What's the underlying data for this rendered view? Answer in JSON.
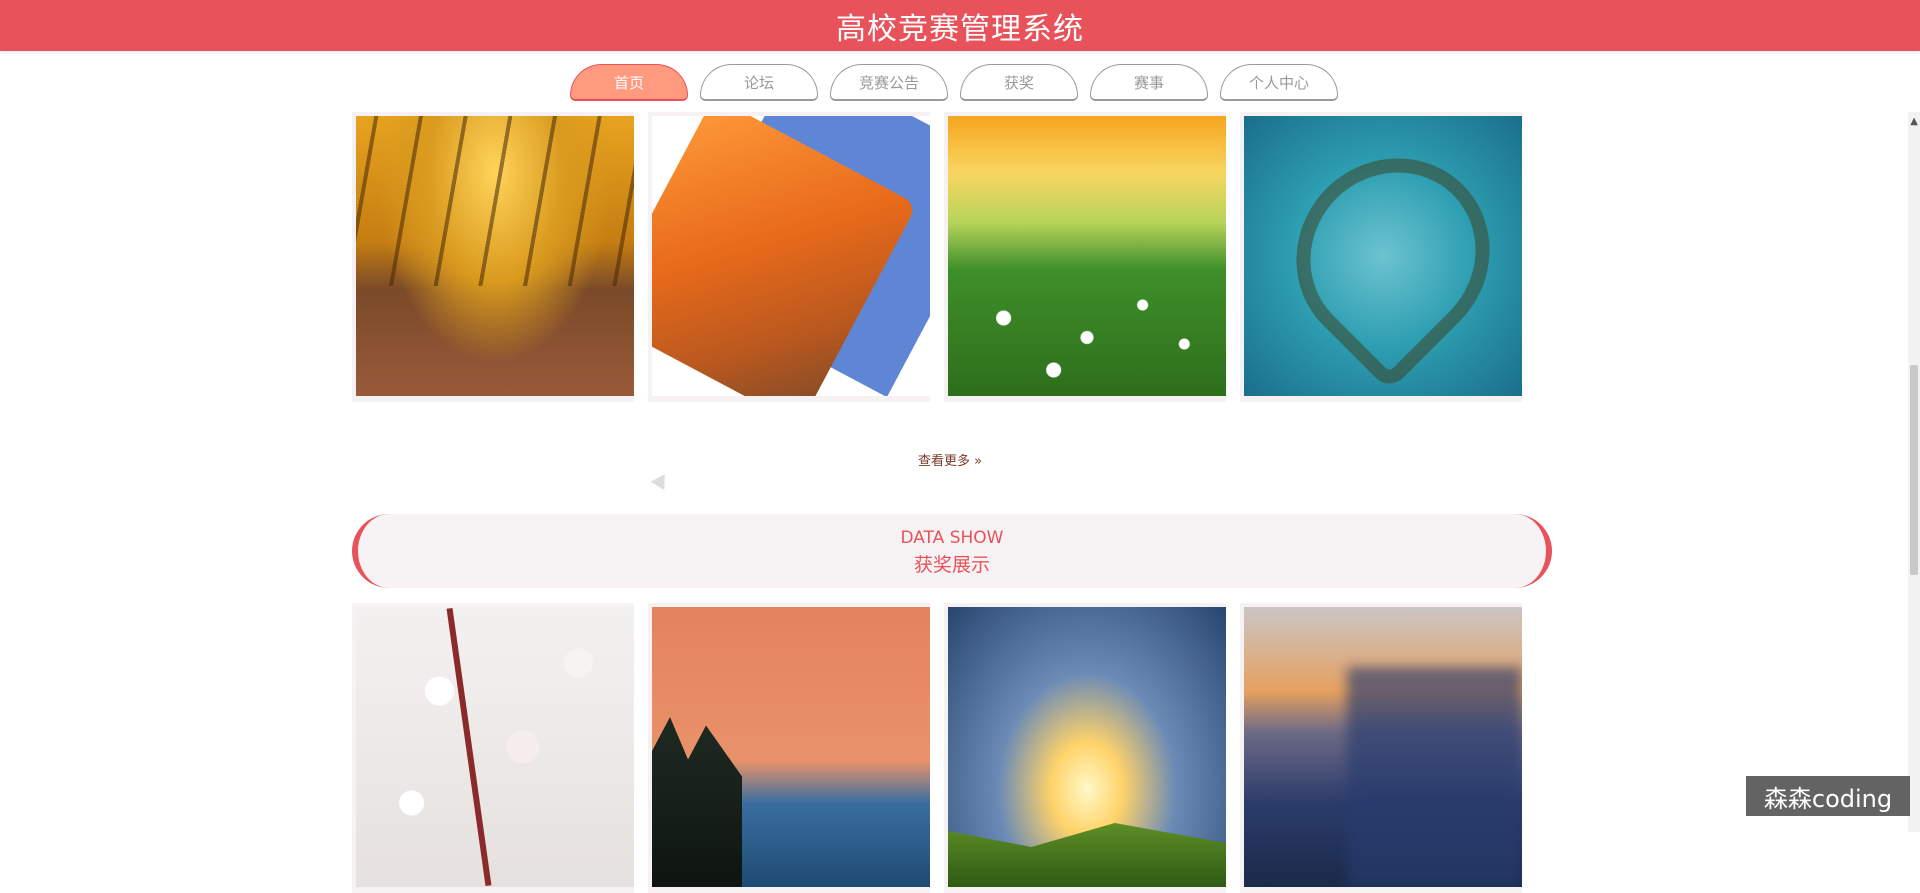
{
  "header": {
    "title": "高校竞赛管理系统"
  },
  "nav": {
    "tabs": [
      "首页",
      "论坛",
      "竞赛公告",
      "获奖",
      "赛事",
      "个人中心"
    ],
    "active_index": 0
  },
  "top_gallery": {
    "item_count": 4
  },
  "more_link": {
    "label": "查看更多 »"
  },
  "section": {
    "en_title": "DATA SHOW",
    "cn_title": "获奖展示"
  },
  "bottom_gallery": {
    "item_count": 4
  },
  "watermark": {
    "text": "森森coding"
  },
  "colors": {
    "accent": "#e8525a",
    "active_tab": "#ff9a7e"
  }
}
